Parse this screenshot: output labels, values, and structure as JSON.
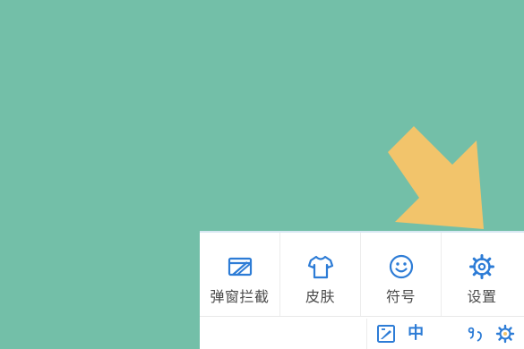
{
  "menu": {
    "items": [
      {
        "label": "弹窗拦截",
        "icon": "popup-block-icon"
      },
      {
        "label": "皮肤",
        "icon": "shirt-icon"
      },
      {
        "label": "符号",
        "icon": "smiley-icon"
      },
      {
        "label": "设置",
        "icon": "gear-icon"
      }
    ]
  },
  "toolbar": {
    "lang_label": "中",
    "icons": [
      "toolbox-icon",
      "chinese-mode-icon",
      "moon-icon",
      "punctuation-icon",
      "settings-gear-icon"
    ]
  },
  "colors": {
    "background": "#73bfa8",
    "arrow": "#f2c46b",
    "accent": "#2d7cd6",
    "label": "#4a4a4a"
  }
}
